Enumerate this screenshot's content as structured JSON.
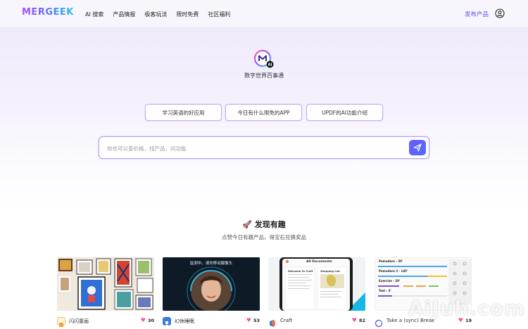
{
  "header": {
    "logo": "MERGEEK",
    "nav": [
      "AI 搜索",
      "产品情报",
      "极客玩法",
      "限时免费",
      "社区福利"
    ],
    "publish": "发布产品"
  },
  "hero": {
    "badge": "AI",
    "tagline": "数字世界百事通"
  },
  "chips": [
    "学习英语的好应用",
    "今日有什么限免的APP",
    "UPDF的AI功能介绍"
  ],
  "search": {
    "placeholder": "你也可以查价格，找产品，问功能"
  },
  "discover": {
    "emoji": "🚀",
    "title": "发现有趣",
    "subtitle": "点赞今日有趣产品，得宝石兑换奖品"
  },
  "cards": [
    {
      "name": "闪闪童画",
      "likes": "30"
    },
    {
      "name": "幻休睡眠",
      "likes": "53",
      "overlay": "监测中，请勿移动摄像头"
    },
    {
      "name": "Craft",
      "likes": "82",
      "header": "All Documents",
      "note1": "Welcome To Craft",
      "note2": "Shopping List"
    },
    {
      "name": "Take a (sync) Break",
      "likes": "19",
      "rows": [
        "Pomodoro - 30'",
        "Pomodoro 2 - 145'",
        "Exercise - 30'",
        "Test - 3'"
      ]
    }
  ],
  "watermark": "AiJuh.com",
  "colors": {
    "accent": "#5b4bff",
    "heart": "#ff4fa3",
    "chip_border": "#c9a8f0"
  }
}
